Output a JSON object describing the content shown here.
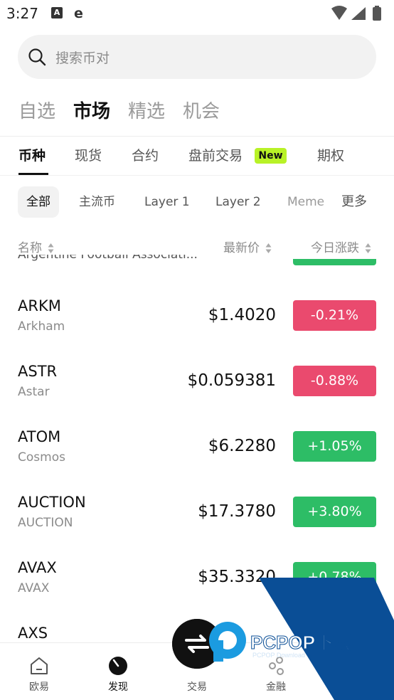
{
  "status_bar": {
    "time": "3:27",
    "icon_a": "A",
    "icon_e": "e"
  },
  "search": {
    "placeholder": "搜索币对"
  },
  "main_tabs": [
    {
      "label": "自选"
    },
    {
      "label": "市场"
    },
    {
      "label": "精选"
    },
    {
      "label": "机会"
    }
  ],
  "sub_tabs": [
    {
      "label": "币种"
    },
    {
      "label": "现货"
    },
    {
      "label": "合约"
    },
    {
      "label": "盘前交易"
    },
    {
      "label": "期权"
    }
  ],
  "new_badge": "New",
  "filters": [
    {
      "label": "全部"
    },
    {
      "label": "主流币"
    },
    {
      "label": "Layer 1"
    },
    {
      "label": "Layer 2"
    },
    {
      "label": "Meme"
    }
  ],
  "filter_more": "更多",
  "columns": {
    "name": "名称",
    "price": "最新价",
    "change": "今日涨跌"
  },
  "partial_row_name": "Argentine Football Associati...",
  "coins": [
    {
      "symbol": "ARKM",
      "name": "Arkham",
      "price": "$1.4020",
      "change": "-0.21%",
      "direction": "down"
    },
    {
      "symbol": "ASTR",
      "name": "Astar",
      "price": "$0.059381",
      "change": "-0.88%",
      "direction": "down"
    },
    {
      "symbol": "ATOM",
      "name": "Cosmos",
      "price": "$6.2280",
      "change": "+1.05%",
      "direction": "up"
    },
    {
      "symbol": "AUCTION",
      "name": "AUCTION",
      "price": "$17.3780",
      "change": "+3.80%",
      "direction": "up"
    },
    {
      "symbol": "AVAX",
      "name": "AVAX",
      "price": "$35.3320",
      "change": "+0.78%",
      "direction": "up"
    },
    {
      "symbol": "AXS",
      "name": "",
      "price": "",
      "change": "",
      "direction": "up"
    }
  ],
  "bottom_nav": [
    {
      "label": "欧易",
      "icon": "home-icon"
    },
    {
      "label": "发现",
      "icon": "discover-icon"
    },
    {
      "label": "交易",
      "icon": "trade-icon"
    },
    {
      "label": "金融",
      "icon": "finance-icon"
    }
  ],
  "watermark": {
    "brand": "PCPOP下载",
    "tagline": "PCPOP Download"
  },
  "colors": {
    "up": "#2dbd66",
    "down": "#ea4a6e",
    "new_badge": "#b8f227"
  }
}
